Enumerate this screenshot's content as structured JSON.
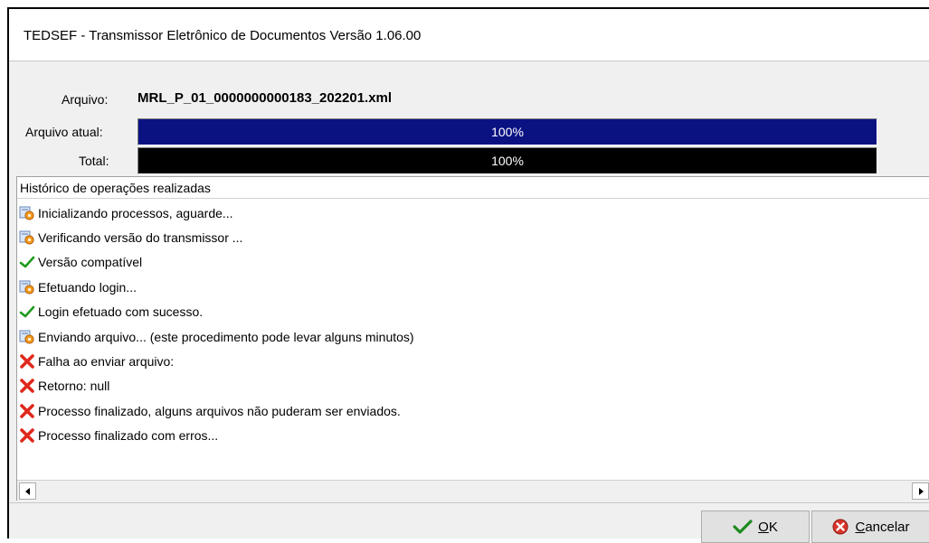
{
  "window": {
    "title": "TEDSEF - Transmissor Eletrônico de Documentos  Versão 1.06.00"
  },
  "header": {
    "file_label": "Arquivo:",
    "file_name": "MRL_P_01_0000000000183_202201.xml",
    "current_label": "Arquivo atual:",
    "current_progress": 1.0,
    "current_text": "100%",
    "total_label": "Total:",
    "total_progress": 1.0,
    "total_text": "100%",
    "colors": {
      "current_bar": "#0a1282",
      "total_bar": "#000000"
    }
  },
  "history": {
    "title": "Histórico de operações realizadas",
    "entries": [
      {
        "icon": "process-gear-icon",
        "text": "Inicializando processos, aguarde..."
      },
      {
        "icon": "process-gear-icon",
        "text": "Verificando versão do transmissor ..."
      },
      {
        "icon": "check-icon",
        "text": "Versão compatível"
      },
      {
        "icon": "process-gear-icon",
        "text": "Efetuando login..."
      },
      {
        "icon": "check-icon",
        "text": "Login efetuado com sucesso."
      },
      {
        "icon": "process-gear-icon",
        "text": "Enviando arquivo... (este procedimento pode levar alguns minutos)"
      },
      {
        "icon": "error-x-icon",
        "text": "Falha ao enviar arquivo:"
      },
      {
        "icon": "error-x-icon",
        "text": "Retorno: null"
      },
      {
        "icon": "error-x-icon",
        "text": "Processo finalizado, alguns arquivos não puderam ser enviados."
      },
      {
        "icon": "error-x-icon",
        "text": "Processo finalizado com erros..."
      }
    ]
  },
  "footer": {
    "ok_mnemonic": "O",
    "ok_rest": "K",
    "cancel_mnemonic": "C",
    "cancel_rest": "ancelar"
  }
}
